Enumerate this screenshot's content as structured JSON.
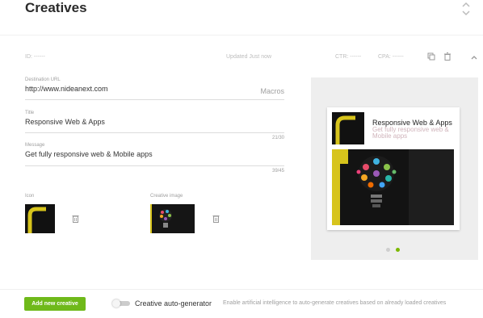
{
  "header": {
    "title": "Creatives"
  },
  "meta": {
    "id": "ID: ------",
    "updated": "Updated Just now",
    "ctr": "CTR: ------",
    "cpa": "CPA: ------"
  },
  "form": {
    "destination": {
      "label": "Destination URL",
      "value": "http://www.nideanext.com",
      "macros": "Macros"
    },
    "title": {
      "label": "Title",
      "value": "Responsive Web & Apps",
      "counter": "21/30"
    },
    "message": {
      "label": "Message",
      "value": "Get fully responsive web & Mobile apps",
      "counter": "39/45"
    },
    "icon_label": "Icon",
    "creative_image_label": "Creative image"
  },
  "preview": {
    "title": "Responsive Web & Apps",
    "subtitle": "Get fully responsive web & Mobile apps"
  },
  "footer": {
    "add_button": "Add new creative",
    "toggle_label": "Creative auto-generator",
    "toggle_hint": "Enable artificial intelligence to auto-generate creatives based on already loaded creatives"
  },
  "colors": {
    "accent": "#6fb91a",
    "logo_yellow": "#d7c41c"
  }
}
